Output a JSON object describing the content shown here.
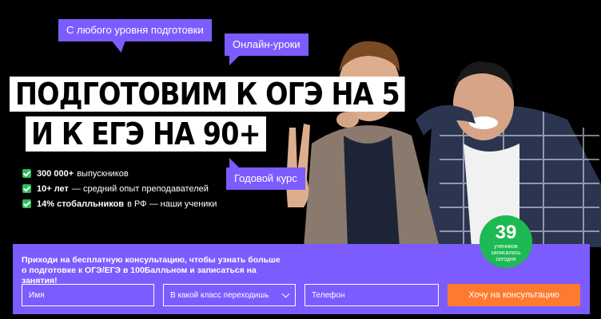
{
  "bubbles": {
    "levels": "С любого уровня подготовки",
    "online": "Онлайн-уроки",
    "annual": "Годовой курс"
  },
  "headline": {
    "line1": "ПОДГОТОВИМ К ОГЭ НА 5",
    "line2": "И К ЕГЭ НА 90+"
  },
  "bullets": [
    {
      "bold": "300 000+",
      "text": "выпускников"
    },
    {
      "bold": "10+ лет",
      "text": "— средний опыт преподавателей"
    },
    {
      "bold": "14% стобалльников",
      "text": "в РФ — наши ученики"
    }
  ],
  "badge": {
    "number": "39",
    "text": "учеников записалось сегодня",
    "color": "#1db954"
  },
  "consult": {
    "text": "Приходи на бесплатную консультацию, чтобы узнать больше о подготовке к ОГЭ/ЕГЭ в 100Балльном и записаться на занятия!",
    "name_placeholder": "Имя",
    "class_select_value": "В какой класс переходишь",
    "phone_placeholder": "Телефон",
    "cta_label": "Хочу на консультацию"
  },
  "colors": {
    "accent": "#7c5cff",
    "cta": "#ff7a2e",
    "check": "#2bbd5b",
    "background": "#000000"
  }
}
